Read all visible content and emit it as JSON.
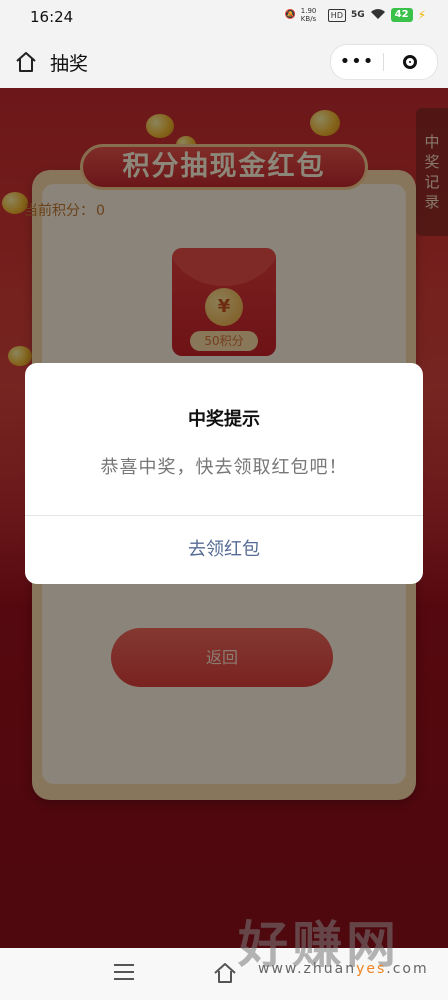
{
  "status_bar": {
    "time": "16:24",
    "speed": "1.90 KB/s",
    "hd": "HD",
    "network": "5G",
    "battery": "42"
  },
  "navbar": {
    "title": "抽奖",
    "more_icon": "more-dots-icon",
    "close_icon": "target-circle-icon"
  },
  "page": {
    "banner_title": "积分抽现金红包",
    "points_label": "当前积分：",
    "points_value": "0",
    "envelope_symbol": "¥",
    "envelope_cost": "50积分",
    "back_button": "返回",
    "prize_record_tab": [
      "中",
      "奖",
      "记",
      "录"
    ]
  },
  "modal": {
    "title": "中奖提示",
    "message": "恭喜中奖，快去领取红包吧！",
    "action_button": "去领红包"
  },
  "watermark": {
    "big": "好赚网",
    "small_prefix": "www.zhuan",
    "small_accent": "yes",
    "small_suffix": ".com"
  },
  "colors": {
    "page_red": "#c52a2f",
    "modal_button": "#566b94",
    "points_text": "#c2772f"
  }
}
